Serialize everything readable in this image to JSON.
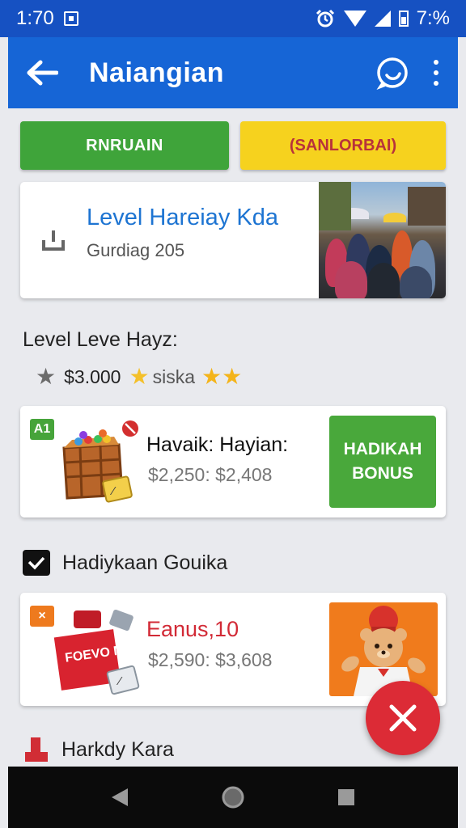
{
  "status_bar": {
    "time": "1:70",
    "battery": "7:%"
  },
  "app_bar": {
    "title": "Naiangian"
  },
  "tabs": {
    "green_label": "RNRUAIN",
    "yellow_label": "(SANLORBAI)"
  },
  "level_card": {
    "title": "Level Hareiay Kda",
    "subtitle": "Gurdiag 205"
  },
  "level_section": {
    "label": "Level Leve Hayz:",
    "price": "$3.000",
    "tag": "siska"
  },
  "prize_card": {
    "badge": "A1",
    "name": "Havaik: Hayian:",
    "range": "$2,250: $2,408",
    "button_label_line1": "HADIKAH",
    "button_label_line2": "BONUS"
  },
  "checkbox_section": {
    "label": "Hadiykaan Gouika",
    "checked": true
  },
  "bonus_card": {
    "badge": "×",
    "name": "Eanus,10",
    "range": "$2,590: $3,608",
    "box_text": "FOEVO NEBR"
  },
  "bottom_section": {
    "label": "Harkdy Kara"
  },
  "colors": {
    "status_bar": "#1651c2",
    "app_bar": "#1665d6",
    "green": "#3fa43a",
    "yellow": "#f6d21e",
    "red": "#dc2b36",
    "orange": "#f07b1c"
  },
  "icons": {
    "back": "arrow-left-icon",
    "chat": "chat-bubble-icon",
    "more": "more-vertical-icon",
    "download": "download-icon",
    "star": "star-icon",
    "check": "check-icon",
    "close": "close-icon",
    "nav_back": "triangle-back-icon",
    "nav_home": "circle-home-icon",
    "nav_recents": "square-recents-icon"
  }
}
